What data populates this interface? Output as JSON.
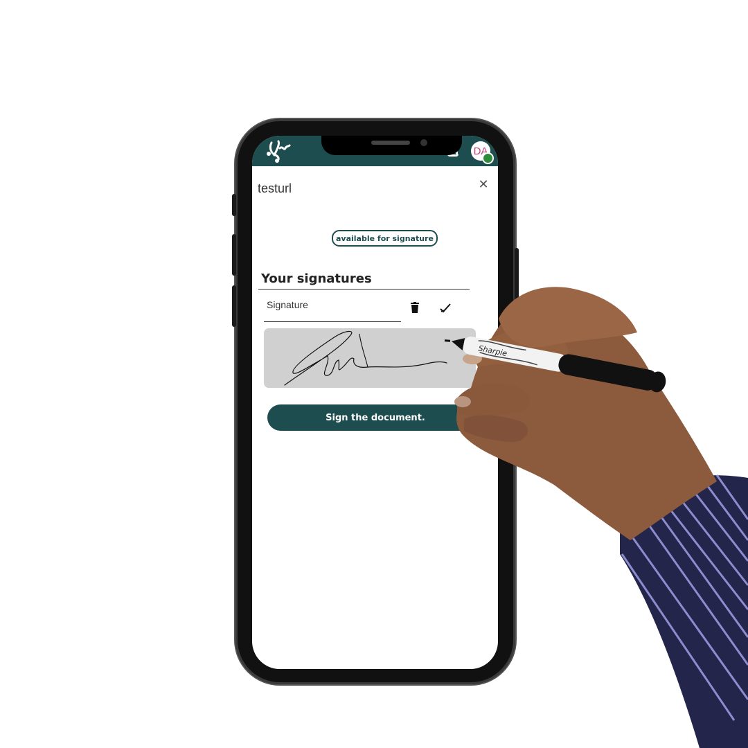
{
  "app": {
    "brand_color": "#1e4d4f",
    "logo_icon": "signature-logo-icon",
    "avatar_initials": "DA",
    "avatar_status_color": "#2e8b3a"
  },
  "document": {
    "title": "testurl",
    "status_badge": "available for signature"
  },
  "signatures": {
    "heading": "Your signatures",
    "field_label": "Signature",
    "pad_background": "#d0d0d0"
  },
  "actions": {
    "sign_label": "Sign the document."
  }
}
